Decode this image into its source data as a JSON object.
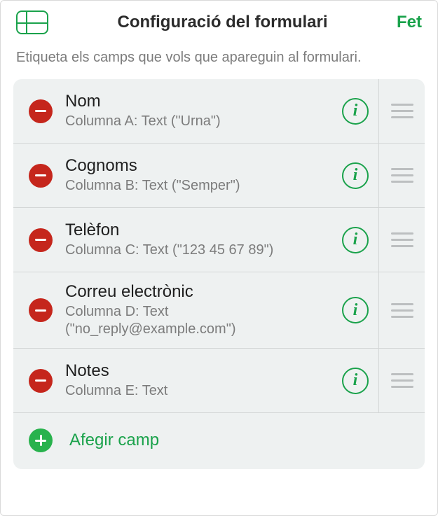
{
  "header": {
    "title": "Configuració del formulari",
    "done": "Fet"
  },
  "subtitle": "Etiqueta els camps que vols que apareguin al formulari.",
  "fields": [
    {
      "name": "Nom",
      "detail": "Columna A: Text (\"Urna\")"
    },
    {
      "name": "Cognoms",
      "detail": "Columna B: Text (\"Semper\")"
    },
    {
      "name": "Telèfon",
      "detail": "Columna C: Text (\"123 45 67 89\")"
    },
    {
      "name": "Correu electrònic",
      "detail": "Columna D: Text (\"no_reply@example.com\")"
    },
    {
      "name": "Notes",
      "detail": "Columna E: Text"
    }
  ],
  "add_field_label": "Afegir camp",
  "colors": {
    "accent": "#1aa24b",
    "destructive": "#c5261c"
  }
}
